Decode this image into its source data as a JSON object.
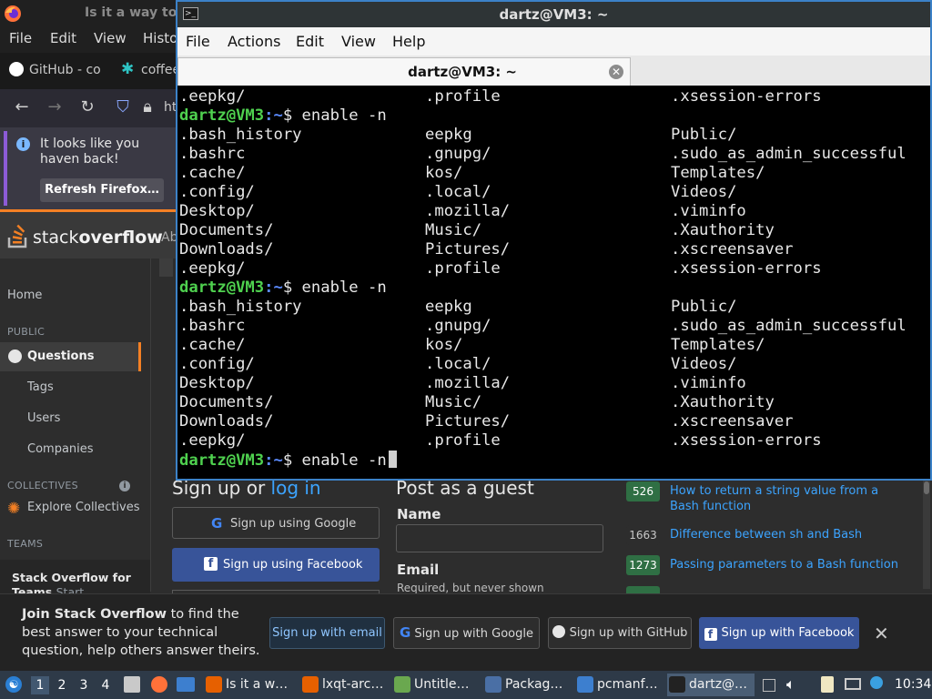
{
  "firefox": {
    "title": "Is it a way to",
    "menu": [
      "File",
      "Edit",
      "View",
      "Histo"
    ],
    "tabs": [
      "GitHub - co",
      "coffee"
    ],
    "url_partial": "ht",
    "notice": {
      "text": "It looks like you haven back!",
      "button": "Refresh Firefox…"
    }
  },
  "stackoverflow": {
    "logo_pre": "stack",
    "logo_bold": "overflow",
    "about": "Ab",
    "sidebar": {
      "home": "Home",
      "public_heading": "PUBLIC",
      "questions": "Questions",
      "tags": "Tags",
      "users": "Users",
      "companies": "Companies",
      "collectives_heading": "COLLECTIVES",
      "explore_collectives": "Explore Collectives",
      "teams_heading": "TEAMS",
      "teams_title": "Stack Overflow for Teams",
      "teams_start": "Start"
    },
    "signup": {
      "title_pre": "Sign up or ",
      "title_link": "log in",
      "google": "Sign up using Google",
      "facebook": "Sign up using Facebook"
    },
    "guest": {
      "title": "Post as a guest",
      "name_label": "Name",
      "email_label": "Email",
      "email_help": "Required, but never shown"
    },
    "related": [
      {
        "score": "526",
        "title": "How to return a string value from a Bash function",
        "style": "green"
      },
      {
        "score": "1663",
        "title": "Difference between sh and Bash",
        "style": "dark"
      },
      {
        "score": "1273",
        "title": "Passing parameters to a Bash function",
        "style": "green"
      }
    ],
    "join_banner": {
      "bold": "Join Stack Overflow",
      "rest": " to find the best answer to your technical question, help others answer theirs.",
      "buttons": {
        "email": "Sign up with email",
        "google": "Sign up with Google",
        "github": "Sign up with GitHub",
        "facebook": "Sign up with Facebook"
      }
    }
  },
  "terminal": {
    "window_title": "dartz@VM3: ~",
    "menu": [
      "File",
      "Actions",
      "Edit",
      "View",
      "Help"
    ],
    "tab_title": "dartz@VM3: ~",
    "prompt_user": "dartz@VM3",
    "prompt_path": ":~",
    "prompt_sign": "$ ",
    "command": "enable -n",
    "top_partial": [
      ".eepkg/",
      ".profile",
      ".xsession-errors"
    ],
    "listing": [
      [
        ".bash_history",
        "eepkg",
        "Public/"
      ],
      [
        ".bashrc",
        ".gnupg/",
        ".sudo_as_admin_successful"
      ],
      [
        ".cache/",
        "kos/",
        "Templates/"
      ],
      [
        ".config/",
        ".local/",
        "Videos/"
      ],
      [
        "Desktop/",
        ".mozilla/",
        ".viminfo"
      ],
      [
        "Documents/",
        "Music/",
        ".Xauthority"
      ],
      [
        "Downloads/",
        "Pictures/",
        ".xscreensaver"
      ],
      [
        ".eepkg/",
        ".profile",
        ".xsession-errors"
      ]
    ]
  },
  "taskbar": {
    "workspaces": [
      "1",
      "2",
      "3",
      "4"
    ],
    "tasks": [
      {
        "label": "Is it a w…",
        "icon": "firefox-icon",
        "color": "#e66000"
      },
      {
        "label": "lxqt-arc…",
        "icon": "firefox-icon",
        "color": "#e66000"
      },
      {
        "label": "Untitle…",
        "icon": "text-editor-icon",
        "color": "#6aa84f"
      },
      {
        "label": "Packag…",
        "icon": "package-icon",
        "color": "#4a6fa5"
      },
      {
        "label": "pcmanf…",
        "icon": "folder-icon",
        "color": "#3d7fcf"
      },
      {
        "label": "dartz@…",
        "icon": "terminal-icon",
        "color": "#222222"
      }
    ],
    "clock": "10:34"
  }
}
